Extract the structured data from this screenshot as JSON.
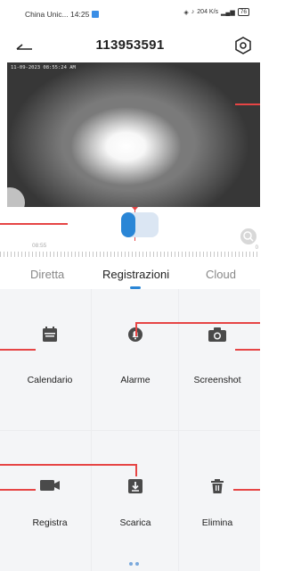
{
  "status_bar": {
    "carrier_time": "China Unic... 14:25",
    "net_speed": "204 K/s",
    "battery": "76"
  },
  "nav": {
    "title": "113953591"
  },
  "video": {
    "timestamp": "11-09-2023 08:55:24 AM"
  },
  "timeline": {
    "time_label": "08:55",
    "end_label": "0"
  },
  "tabs": [
    {
      "label": "Diretta",
      "active": false
    },
    {
      "label": "Registrazioni",
      "active": true
    },
    {
      "label": "Cloud",
      "active": false
    }
  ],
  "actions": [
    {
      "label": "Calendario",
      "icon": "calendar-icon"
    },
    {
      "label": "Alarme",
      "icon": "bell-icon"
    },
    {
      "label": "Screenshot",
      "icon": "camera-icon"
    },
    {
      "label": "Registra",
      "icon": "video-camera-icon"
    },
    {
      "label": "Scarica",
      "icon": "download-icon"
    },
    {
      "label": "Elimina",
      "icon": "trash-icon"
    }
  ],
  "colors": {
    "accent": "#2a86d6",
    "annotation": "#e64545",
    "icon": "#4a4a4a"
  }
}
